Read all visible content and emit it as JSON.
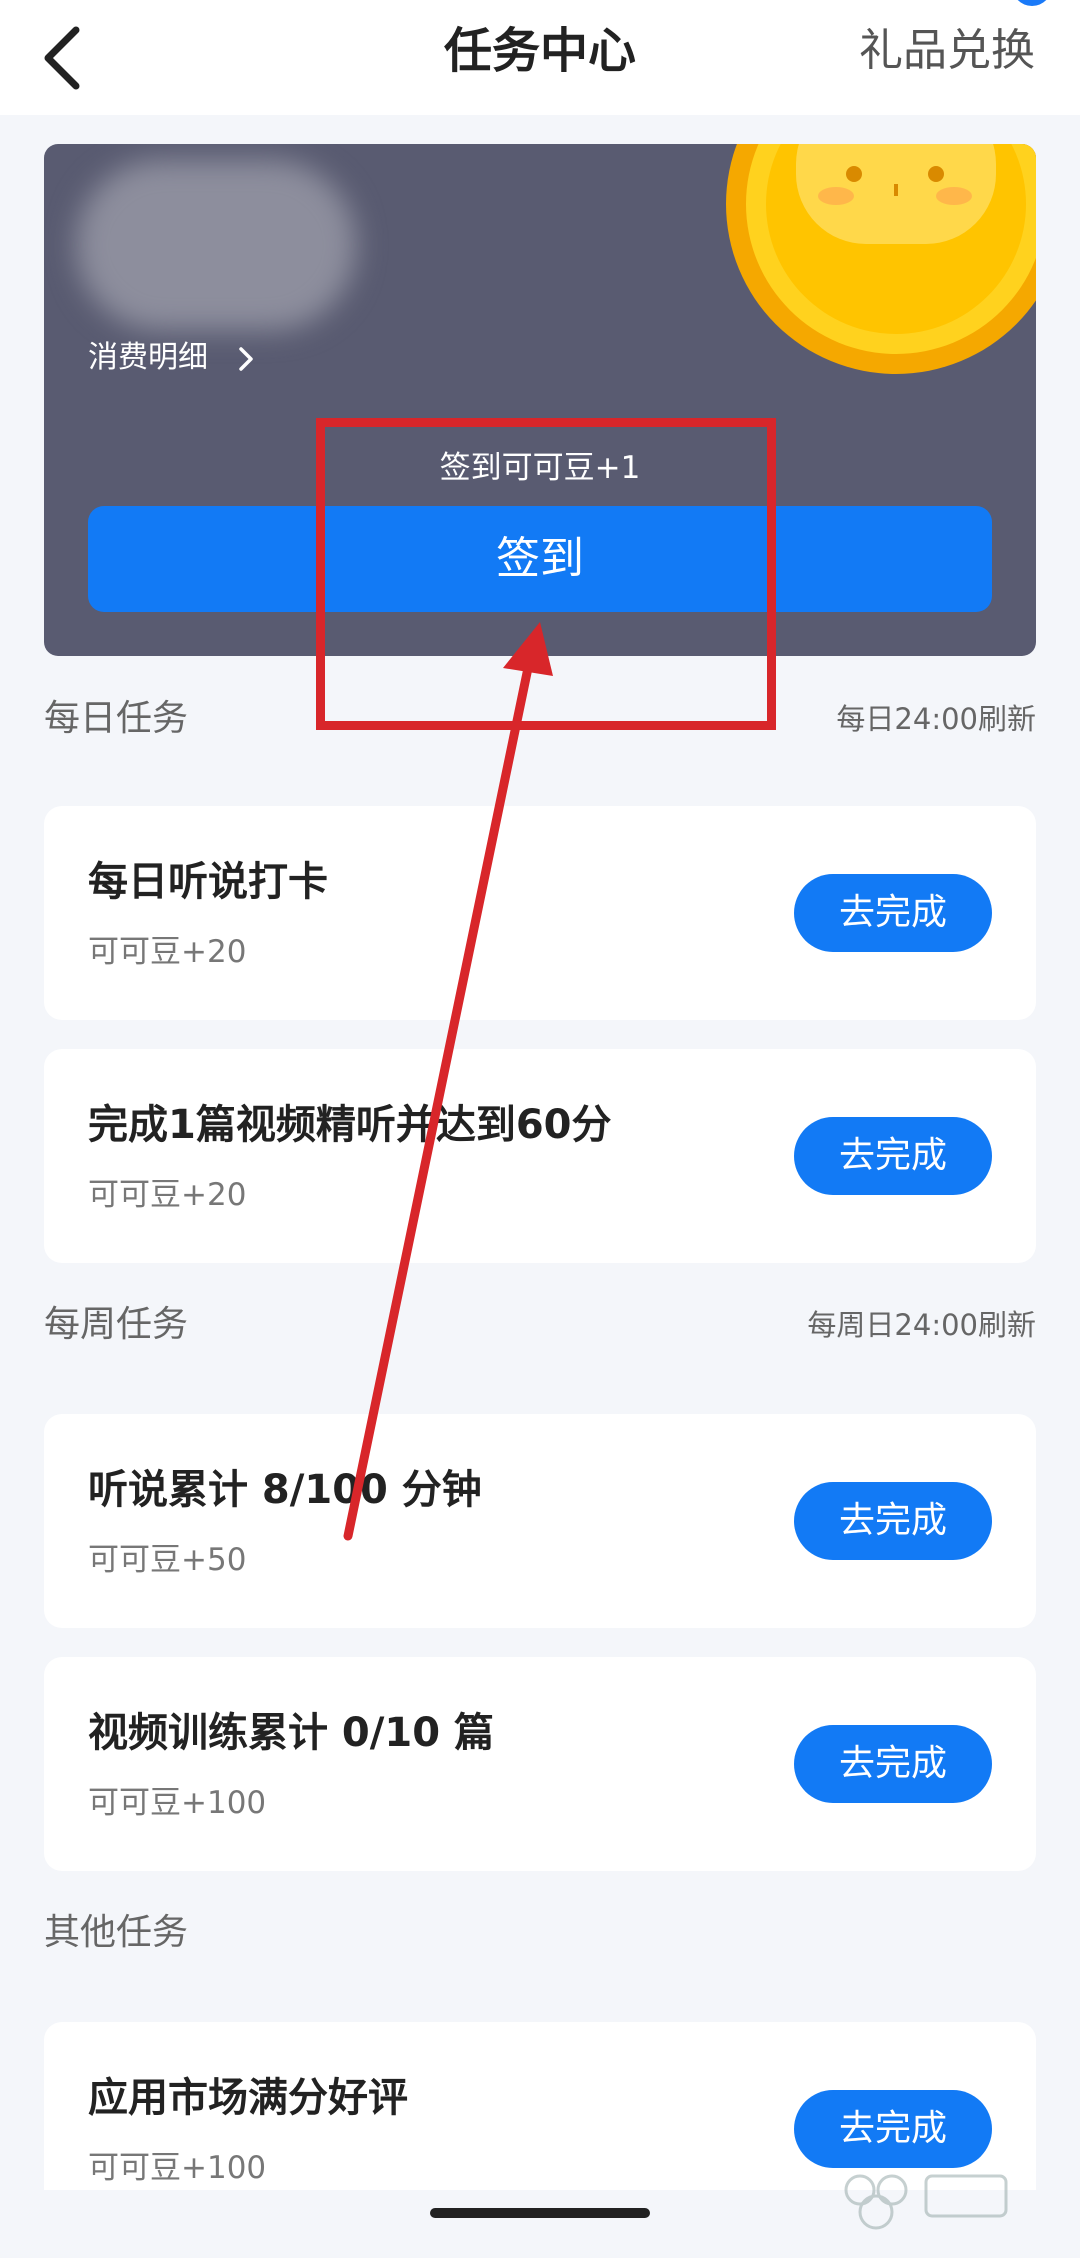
{
  "header": {
    "title": "任务中心",
    "gift_link": "礼品兑换"
  },
  "balance_card": {
    "detail_link": "消费明细",
    "reward_note": "签到可可豆+1",
    "signin_button": "签到"
  },
  "sections": [
    {
      "title": "每日任务",
      "refresh_note": "每日24:00刷新",
      "tasks": [
        {
          "name": "每日听说打卡",
          "reward": "可可豆+20",
          "action": "去完成"
        },
        {
          "name": "完成1篇视频精听并达到60分",
          "reward": "可可豆+20",
          "action": "去完成"
        }
      ]
    },
    {
      "title": "每周任务",
      "refresh_note": "每周日24:00刷新",
      "tasks": [
        {
          "name": "听说累计 8/100 分钟",
          "reward": "可可豆+50",
          "action": "去完成"
        },
        {
          "name": "视频训练累计 0/10 篇",
          "reward": "可可豆+100",
          "action": "去完成"
        }
      ]
    },
    {
      "title": "其他任务",
      "refresh_note": "",
      "tasks": [
        {
          "name": "应用市场满分好评",
          "reward": "可可豆+100",
          "action": "去完成"
        }
      ]
    }
  ],
  "colors": {
    "accent": "#127af5",
    "card_bg": "#595b71",
    "annotation": "#d8262a",
    "page_bg": "#f4f6fa"
  },
  "icons": [
    "back-arrow-icon",
    "chevron-right-icon",
    "coin-mascot-icon"
  ]
}
